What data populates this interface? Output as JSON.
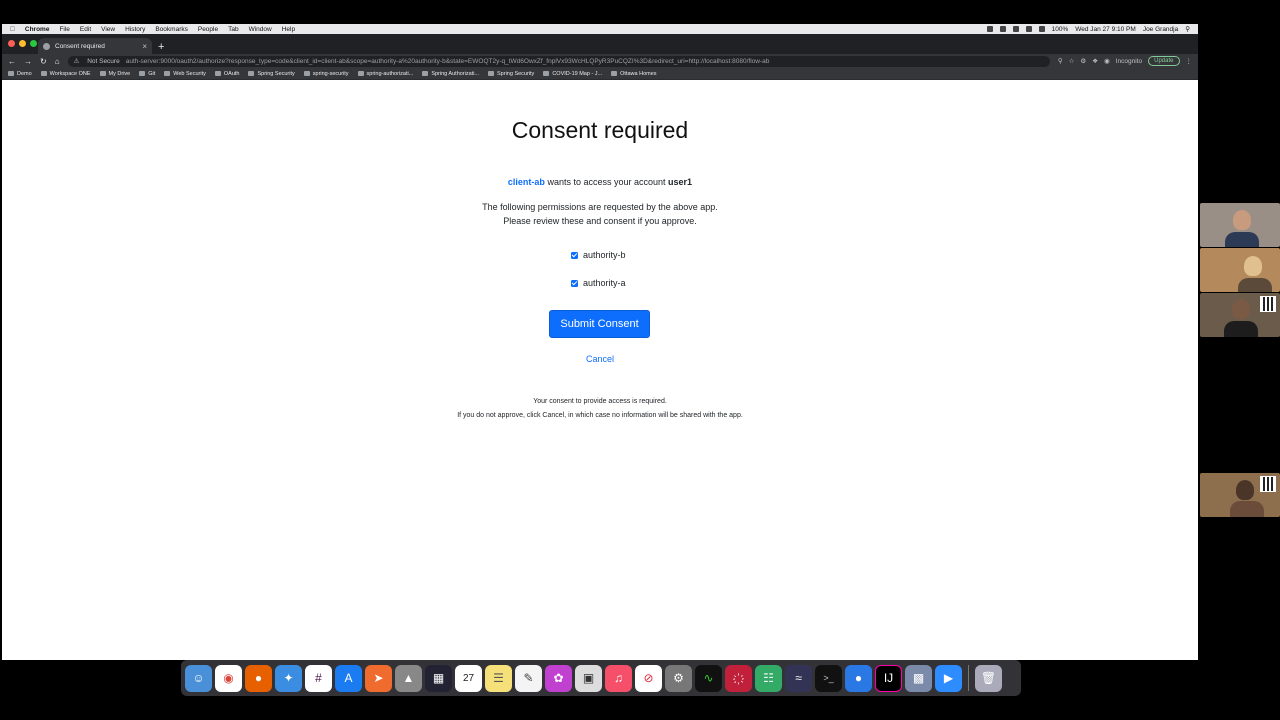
{
  "menubar": {
    "app_name": "Chrome",
    "menus": [
      "File",
      "Edit",
      "View",
      "History",
      "Bookmarks",
      "People",
      "Tab",
      "Window",
      "Help"
    ],
    "battery": "100%",
    "datetime": "Wed Jan 27 9:10 PM",
    "user_name": "Joe Grandja"
  },
  "browser": {
    "tab_title": "Consent required",
    "new_tab_label": "+",
    "not_secure_label": "Not Secure",
    "url": "auth-server:9000/oauth2/authorize?response_type=code&client_id=client-ab&scope=authority-a%20authority-b&state=EWOQT2y-q_tWd6OwxZf_fnplVx93WcHLQPyR3PuCQZI%3D&redirect_uri=http://localhost:8080/flow-ab",
    "incognito_label": "Incognito",
    "update_label": "Update",
    "bookmarks": [
      "Demo",
      "Workspace ONE",
      "My Drive",
      "Git",
      "Web Security",
      "OAuth",
      "Spring Security",
      "spring-security",
      "spring-authorizati...",
      "Spring Authorizati...",
      "Spring Security",
      "COVID-19 Map - J...",
      "Ottawa Homes"
    ]
  },
  "consent": {
    "heading": "Consent required",
    "client_id": "client-ab",
    "request_text": "wants to access your account",
    "user": "user1",
    "permissions_line1": "The following permissions are requested by the above app.",
    "permissions_line2": "Please review these and consent if you approve.",
    "scopes": [
      {
        "label": "authority-b",
        "checked": true
      },
      {
        "label": "authority-a",
        "checked": true
      }
    ],
    "submit_label": "Submit Consent",
    "cancel_label": "Cancel",
    "footnote_line1": "Your consent to provide access is required.",
    "footnote_line2": "If you do not approve, click Cancel, in which case no information will be shared with the app."
  },
  "colors": {
    "primary": "#0d6efd",
    "chrome_dark": "#35363a",
    "traffic_red": "#ff5f57",
    "traffic_yellow": "#febc2e",
    "traffic_green": "#28c840"
  },
  "dock": {
    "apps": [
      "finder-icon",
      "chrome-icon",
      "firefox-icon",
      "safari-icon",
      "slack-icon",
      "app-store-icon",
      "postman-icon",
      "launchpad-icon",
      "mission-control-icon",
      "calendar-icon",
      "notes-icon",
      "textedit-icon",
      "photo-icon",
      "screenshot-icon",
      "music-icon",
      "news-icon",
      "system-preferences-icon",
      "activity-monitor-icon",
      "git-icon",
      "sourcetree-icon",
      "sequel-icon",
      "terminal-icon",
      "maps-icon",
      "intellij-icon",
      "preview-icon",
      "zoom-icon",
      "trash-icon"
    ],
    "calendar_day": "27"
  }
}
